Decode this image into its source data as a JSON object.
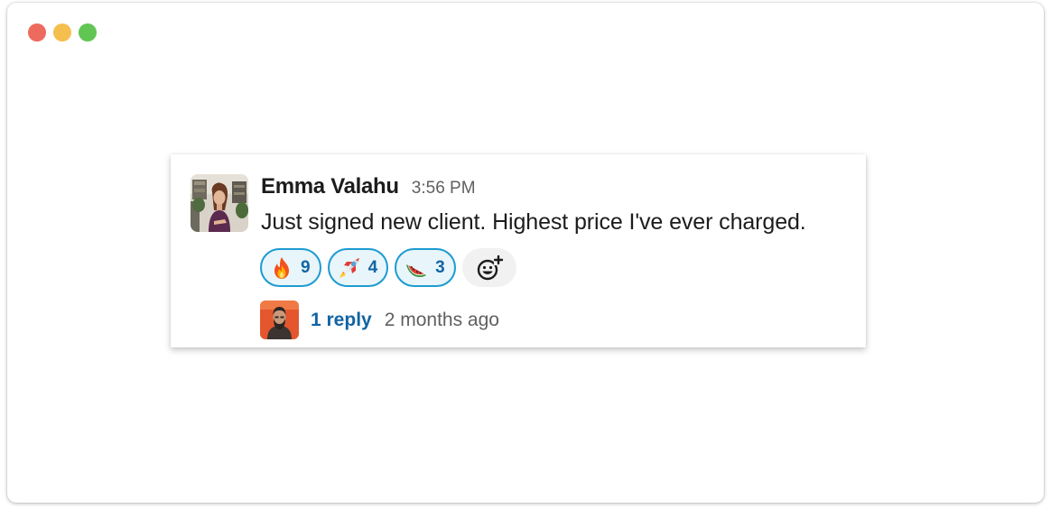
{
  "window": {
    "controls": [
      {
        "name": "close",
        "color": "#ed6a5e"
      },
      {
        "name": "minimize",
        "color": "#f5bf4f"
      },
      {
        "name": "zoom",
        "color": "#61c554"
      }
    ]
  },
  "message": {
    "author": "Emma Valahu",
    "timestamp": "3:56 PM",
    "text": "Just signed new client. Highest price I've ever charged.",
    "reactions": [
      {
        "emoji": "fire-emoji",
        "count": "9"
      },
      {
        "emoji": "rocket-emoji",
        "count": "4"
      },
      {
        "emoji": "watermelon-emoji",
        "count": "3"
      }
    ],
    "add_reaction_icon": "add-reaction-icon",
    "thread": {
      "reply_label": "1 reply",
      "last_reply": "2 months ago"
    }
  },
  "colors": {
    "link": "#1264a3",
    "reaction_border": "#1d9bd1",
    "reaction_bg": "#e8f5fa"
  }
}
